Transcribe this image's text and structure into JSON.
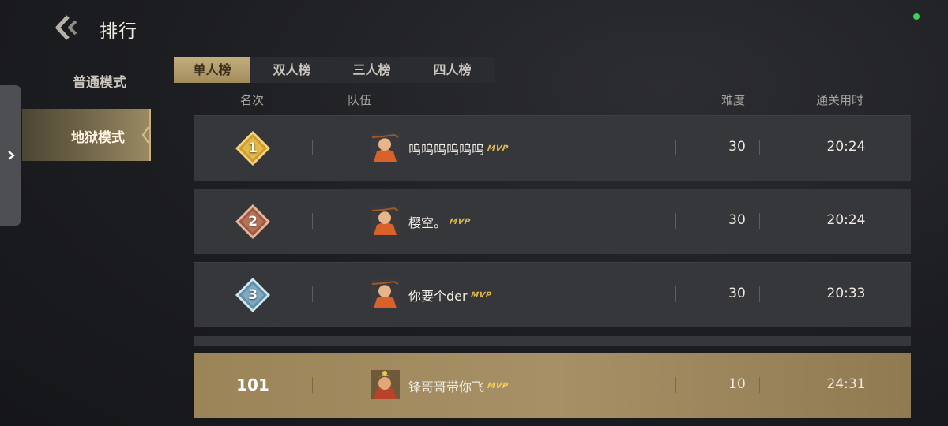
{
  "header": {
    "title": "排行"
  },
  "colors": {
    "accent_gold": "#a89066",
    "online_indicator": "#3fcf5a",
    "row_bg": "#36373b"
  },
  "modes": {
    "normal_label": "普通模式",
    "hell_label": "地狱模式",
    "selected": "地狱模式"
  },
  "tabs": [
    {
      "label": "单人榜",
      "active": true
    },
    {
      "label": "双人榜",
      "active": false
    },
    {
      "label": "三人榜",
      "active": false
    },
    {
      "label": "四人榜",
      "active": false
    }
  ],
  "columns": {
    "rank": "名次",
    "team": "队伍",
    "difficulty": "难度",
    "clear_time": "通关用时"
  },
  "rows": [
    {
      "rank": "1",
      "player": "呜呜呜呜呜呜",
      "mvp": "MVP",
      "difficulty": "30",
      "time": "20:24",
      "badge": "gold"
    },
    {
      "rank": "2",
      "player": "樱空。",
      "mvp": "MVP",
      "difficulty": "30",
      "time": "20:24",
      "badge": "bronze"
    },
    {
      "rank": "3",
      "player": "你要个der",
      "mvp": "MVP",
      "difficulty": "30",
      "time": "20:33",
      "badge": "silver"
    }
  ],
  "my_row": {
    "rank": "101",
    "player": "锋哥哥带你飞",
    "mvp": "MVP",
    "difficulty": "10",
    "time": "24:31"
  },
  "icons": {
    "back": "back-arrow-icon",
    "expand": "chevron-right-icon",
    "rank_badge": "diamond-rank-badge-icon",
    "avatar": "hero-avatar-icon"
  }
}
